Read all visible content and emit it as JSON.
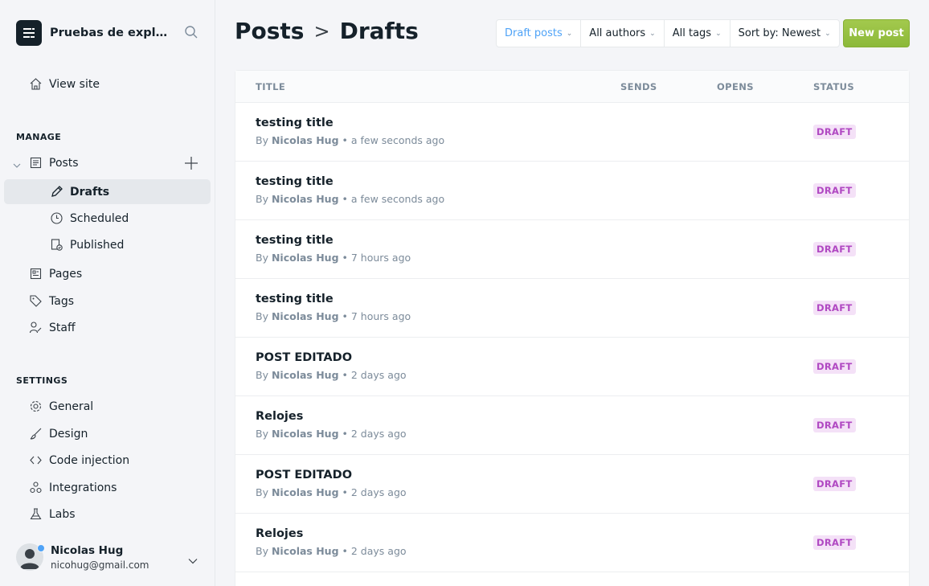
{
  "site": {
    "name": "Pruebas de exploratorias"
  },
  "sidebar": {
    "view_site": "View site",
    "manage_label": "MANAGE",
    "settings_label": "SETTINGS",
    "posts": "Posts",
    "drafts": "Drafts",
    "scheduled": "Scheduled",
    "published": "Published",
    "pages": "Pages",
    "tags": "Tags",
    "staff": "Staff",
    "general": "General",
    "design": "Design",
    "code_injection": "Code injection",
    "integrations": "Integrations",
    "labs": "Labs"
  },
  "user": {
    "name": "Nicolas Hug",
    "email": "nicohug@gmail.com"
  },
  "header": {
    "section": "Posts",
    "separator": ">",
    "page": "Drafts"
  },
  "filters": {
    "type": "Draft posts",
    "authors": "All authors",
    "tags": "All tags",
    "sort": "Sort by: Newest"
  },
  "new_post": "New post",
  "table": {
    "columns": {
      "title": "TITLE",
      "sends": "SENDS",
      "opens": "OPENS",
      "status": "STATUS"
    },
    "rows": [
      {
        "title": "testing title",
        "by": "By",
        "author": "Nicolas Hug",
        "time": "• a few seconds ago",
        "status": "DRAFT"
      },
      {
        "title": "testing title",
        "by": "By",
        "author": "Nicolas Hug",
        "time": "• a few seconds ago",
        "status": "DRAFT"
      },
      {
        "title": "testing title",
        "by": "By",
        "author": "Nicolas Hug",
        "time": "• 7 hours ago",
        "status": "DRAFT"
      },
      {
        "title": "testing title",
        "by": "By",
        "author": "Nicolas Hug",
        "time": "• 7 hours ago",
        "status": "DRAFT"
      },
      {
        "title": "POST EDITADO",
        "by": "By",
        "author": "Nicolas Hug",
        "time": "• 2 days ago",
        "status": "DRAFT"
      },
      {
        "title": "Relojes",
        "by": "By",
        "author": "Nicolas Hug",
        "time": "• 2 days ago",
        "status": "DRAFT"
      },
      {
        "title": "POST EDITADO",
        "by": "By",
        "author": "Nicolas Hug",
        "time": "• 2 days ago",
        "status": "DRAFT"
      },
      {
        "title": "Relojes",
        "by": "By",
        "author": "Nicolas Hug",
        "time": "• 2 days ago",
        "status": "DRAFT"
      }
    ]
  },
  "colors": {
    "accent": "#4fa3f7",
    "primary_button": "#95c040",
    "draft_badge_bg": "#f4e1f7",
    "draft_badge_text": "#b048c2"
  },
  "icons": [
    "search-icon",
    "home-icon",
    "posts-icon",
    "pencil-icon",
    "clock-icon",
    "published-icon",
    "pages-icon",
    "tag-icon",
    "staff-icon",
    "gear-icon",
    "brush-icon",
    "code-icon",
    "integrations-icon",
    "flask-icon",
    "plus-icon",
    "chevron-down-icon"
  ]
}
